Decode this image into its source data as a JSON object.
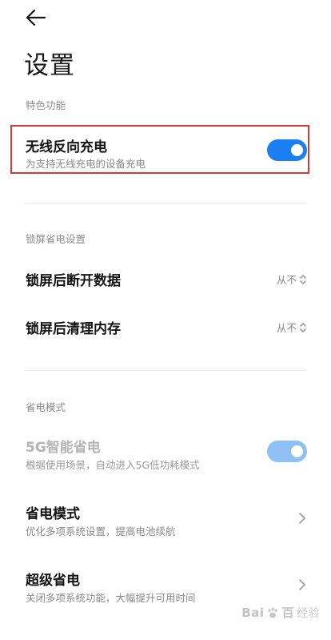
{
  "header": {
    "back_icon": "arrow-left-icon",
    "title": "设置"
  },
  "sections": {
    "featured": {
      "label": "特色功能",
      "wireless_reverse": {
        "title": "无线反向充电",
        "subtitle": "为支持无线充电的设备充电",
        "enabled": true
      }
    },
    "lockscreen": {
      "label": "锁屏省电设置",
      "disconnect_data": {
        "title": "锁屏后断开数据",
        "value": "从不"
      },
      "clear_memory": {
        "title": "锁屏后清理内存",
        "value": "从不"
      }
    },
    "power_mode": {
      "label": "省电模式",
      "smart_5g": {
        "title": "5G智能省电",
        "subtitle": "根据使用场景，自动进入5G低功耗模式",
        "enabled": true,
        "disabled_state": true
      },
      "power_saving": {
        "title": "省电模式",
        "subtitle": "优化多项系统设置，提高电池续航"
      },
      "super_saving": {
        "title": "超级省电",
        "subtitle": "关闭多项系统功能，大幅提升可用时间"
      }
    }
  },
  "watermark": {
    "brand": "Bai",
    "brand_tail": "百",
    "product": "经验"
  },
  "colors": {
    "accent": "#1a7ff0",
    "accent_dim": "#8fc0f5",
    "highlight": "#d23b3b"
  }
}
